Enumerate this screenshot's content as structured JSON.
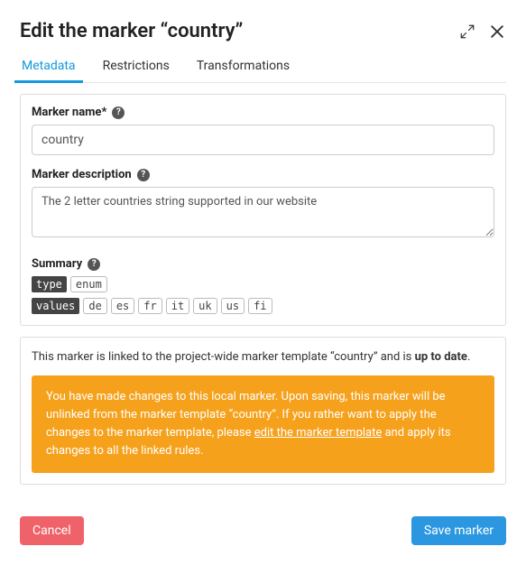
{
  "header": {
    "title": "Edit the marker “country”"
  },
  "tabs": [
    {
      "label": "Metadata"
    },
    {
      "label": "Restrictions"
    },
    {
      "label": "Transformations"
    }
  ],
  "form": {
    "name_label": "Marker name*",
    "name_value": "country",
    "desc_label": "Marker description",
    "desc_value": "The 2 letter countries string supported in our website",
    "summary_label": "Summary",
    "summary": {
      "type_key": "type",
      "type_val": "enum",
      "values_key": "values",
      "values_list": [
        "de",
        "es",
        "fr",
        "it",
        "uk",
        "us",
        "fi"
      ]
    }
  },
  "info": {
    "prefix": "This marker is linked to the project-wide marker template “country” and is ",
    "status": "up to date",
    "suffix": ".",
    "warn_before": "You have made changes to this local marker. Upon saving, this marker will be unlinked from the marker template “country”. If you rather want to apply the changes to the marker template, please ",
    "warn_link": "edit the marker template",
    "warn_after": " and apply its changes to all the linked rules."
  },
  "footer": {
    "cancel": "Cancel",
    "save": "Save marker"
  }
}
